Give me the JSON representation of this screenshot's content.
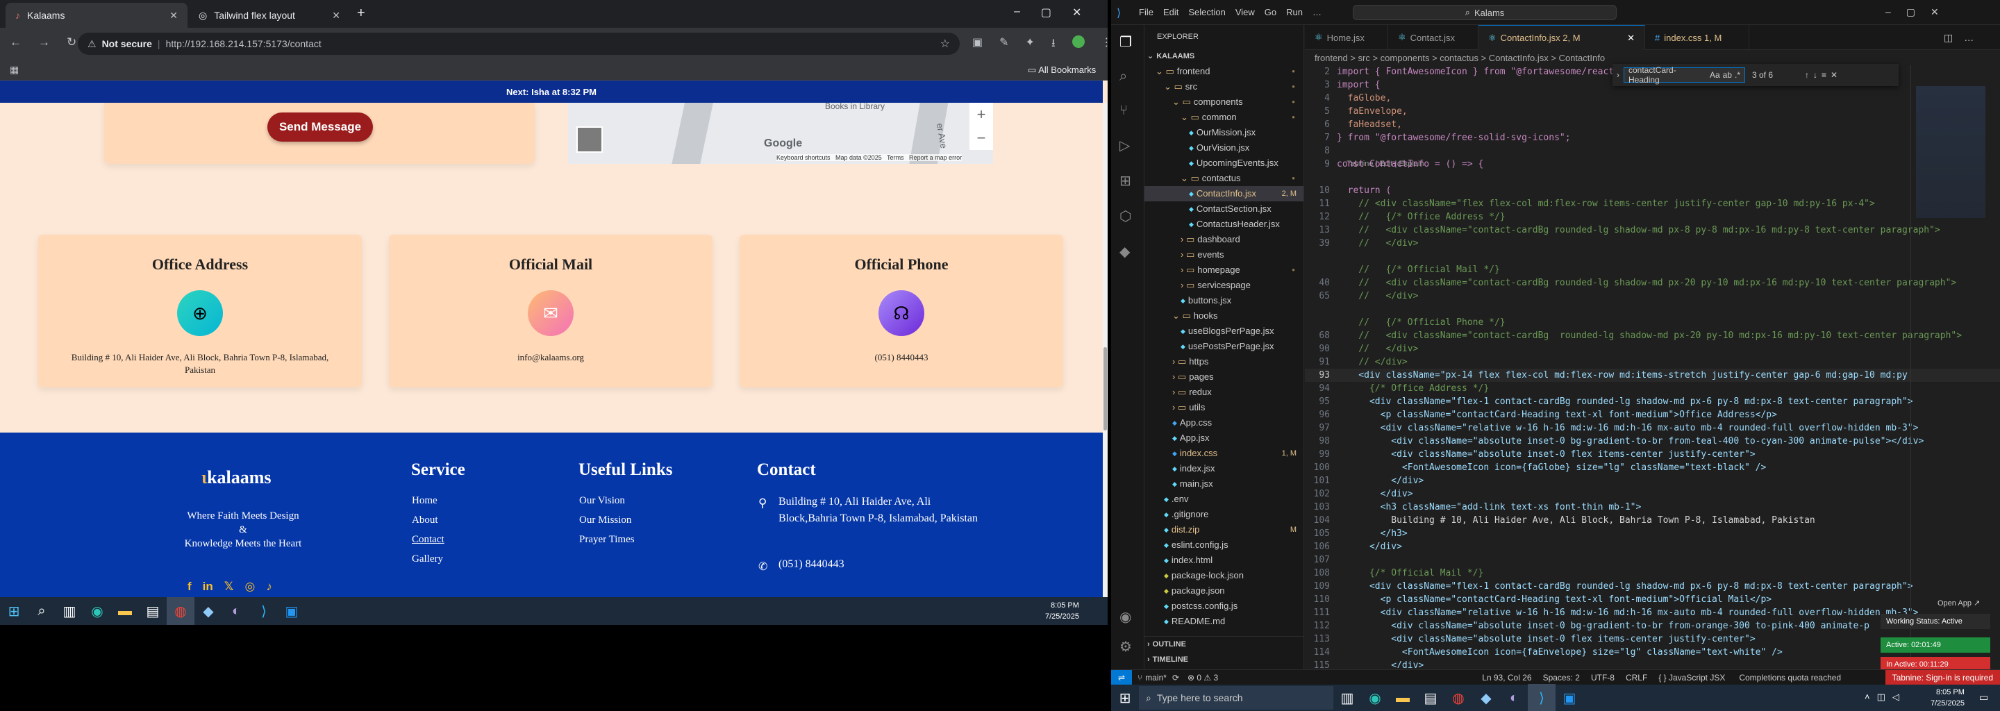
{
  "browser": {
    "tabs": [
      {
        "label": "Kalaams",
        "active": true
      },
      {
        "label": "Tailwind flex layout",
        "active": false
      }
    ],
    "new_tab": "+",
    "window_buttons": [
      "–",
      "▢",
      "✕"
    ],
    "not_secure": "Not secure",
    "url": "http://192.168.214.157:5173/contact",
    "all_bookmarks": "All Bookmarks"
  },
  "site": {
    "announcement": "Next: Isha at 8:32 PM",
    "send_button": "Send Message",
    "map": {
      "zoom_in": "+",
      "zoom_out": "−",
      "attribution": "Keyboard shortcuts   Map data ©2025   Terms   Report a map error",
      "google": "Google",
      "street_1": "Books in Library",
      "street_2": "er Ave"
    },
    "cards": [
      {
        "title": "Office Address",
        "icon": "globe-icon",
        "color": "#14b8a6",
        "text": "Building # 10, Ali Haider Ave, Ali Block, Bahria Town P-8, Islamabad, Pakistan"
      },
      {
        "title": "Official Mail",
        "icon": "envelope-icon",
        "color": "#ec4899",
        "text": "info@kalaams.org"
      },
      {
        "title": "Official Phone",
        "icon": "headset-icon",
        "color": "#6d28d9",
        "text": "(051) 8440443"
      }
    ],
    "footer": {
      "logo": "kalaams",
      "tagline_1": "Where Faith Meets Design",
      "tagline_2": "&",
      "tagline_3": "Knowledge Meets the Heart",
      "service_title": "Service",
      "service_links": [
        "Home",
        "About",
        "Contact",
        "Gallery"
      ],
      "useful_title": "Useful Links",
      "useful_links": [
        "Our Vision",
        "Our Mission",
        "Prayer Times"
      ],
      "contact_title": "Contact",
      "contact_address": "Building # 10, Ali Haider Ave, Ali Block,Bahria Town P-8, Islamabad, Pakistan",
      "contact_phone": "(051) 8440443",
      "socials": [
        "facebook-icon",
        "linkedin-icon",
        "x-icon",
        "instagram-icon",
        "tiktok-icon"
      ]
    }
  },
  "taskbar_left": {
    "time": "8:05 PM",
    "date": "7/25/2025"
  },
  "vscode": {
    "menu": [
      "File",
      "Edit",
      "Selection",
      "View",
      "Go",
      "Run",
      "…"
    ],
    "search": "Kalams",
    "explorer_title": "EXPLORER",
    "root": "KALAAMS",
    "tree": [
      {
        "d": 1,
        "t": "folder",
        "n": "frontend",
        "open": true,
        "dot": true
      },
      {
        "d": 2,
        "t": "folder",
        "n": "src",
        "open": true,
        "dot": true
      },
      {
        "d": 3,
        "t": "folder",
        "n": "components",
        "open": true,
        "dot": true
      },
      {
        "d": 4,
        "t": "folder",
        "n": "common",
        "open": true,
        "dot": true
      },
      {
        "d": 5,
        "t": "file",
        "n": "OurMission.jsx"
      },
      {
        "d": 5,
        "t": "file",
        "n": "OurVision.jsx"
      },
      {
        "d": 5,
        "t": "file",
        "n": "UpcomingEvents.jsx"
      },
      {
        "d": 4,
        "t": "folder",
        "n": "contactus",
        "open": true,
        "dot": true
      },
      {
        "d": 5,
        "t": "file",
        "n": "ContactInfo.jsx",
        "badge": "2, M",
        "selected": true
      },
      {
        "d": 5,
        "t": "file",
        "n": "ContactSection.jsx"
      },
      {
        "d": 5,
        "t": "file",
        "n": "ContactusHeader.jsx"
      },
      {
        "d": 4,
        "t": "folder",
        "n": "dashboard"
      },
      {
        "d": 4,
        "t": "folder",
        "n": "events"
      },
      {
        "d": 4,
        "t": "folder",
        "n": "homepage",
        "dot": true
      },
      {
        "d": 4,
        "t": "folder",
        "n": "servicespage"
      },
      {
        "d": 4,
        "t": "file",
        "n": "buttons.jsx"
      },
      {
        "d": 3,
        "t": "folder",
        "n": "hooks",
        "open": true
      },
      {
        "d": 4,
        "t": "file",
        "n": "useBlogsPerPage.jsx"
      },
      {
        "d": 4,
        "t": "file",
        "n": "usePostsPerPage.jsx"
      },
      {
        "d": 3,
        "t": "folder",
        "n": "https"
      },
      {
        "d": 3,
        "t": "folder",
        "n": "pages"
      },
      {
        "d": 3,
        "t": "folder",
        "n": "redux"
      },
      {
        "d": 3,
        "t": "folder",
        "n": "utils"
      },
      {
        "d": 3,
        "t": "file",
        "n": "App.css"
      },
      {
        "d": 3,
        "t": "file",
        "n": "App.jsx"
      },
      {
        "d": 3,
        "t": "file",
        "n": "index.css",
        "badge": "1, M"
      },
      {
        "d": 3,
        "t": "file",
        "n": "index.jsx"
      },
      {
        "d": 3,
        "t": "file",
        "n": "main.jsx"
      },
      {
        "d": 2,
        "t": "file",
        "n": ".env"
      },
      {
        "d": 2,
        "t": "file",
        "n": ".gitignore"
      },
      {
        "d": 2,
        "t": "file",
        "n": "dist.zip",
        "badge": "M"
      },
      {
        "d": 2,
        "t": "file",
        "n": "eslint.config.js"
      },
      {
        "d": 2,
        "t": "file",
        "n": "index.html"
      },
      {
        "d": 2,
        "t": "file",
        "n": "package-lock.json"
      },
      {
        "d": 2,
        "t": "file",
        "n": "package.json"
      },
      {
        "d": 2,
        "t": "file",
        "n": "postcss.config.js"
      },
      {
        "d": 2,
        "t": "file",
        "n": "README.md"
      }
    ],
    "outline": "OUTLINE",
    "timeline": "TIMELINE",
    "tabs": [
      {
        "n": "Home.jsx"
      },
      {
        "n": "Contact.jsx"
      },
      {
        "n": "ContactInfo.jsx 2, M",
        "active": true
      },
      {
        "n": "index.css 1, M"
      }
    ],
    "breadcrumb": "frontend > src > components > contactus > ContactInfo.jsx > ContactInfo",
    "find": {
      "query": "contactCard-Heading",
      "count": "3 of 6"
    },
    "codelens": "Tabnine | Edit | Explain",
    "lines": [
      {
        "n": "2",
        "c": "import { FontAwesomeIcon } from \"@fortawesome/react-fontawesome\";"
      },
      {
        "n": "3",
        "c": "import {"
      },
      {
        "n": "4",
        "c": "  faGlobe,"
      },
      {
        "n": "5",
        "c": "  faEnvelope,"
      },
      {
        "n": "6",
        "c": "  faHeadset,"
      },
      {
        "n": "7",
        "c": "} from \"@fortawesome/free-solid-svg-icons\";"
      },
      {
        "n": "8",
        "c": ""
      },
      {
        "n": "9",
        "c": "const ContactInfo = () => {"
      },
      {
        "n": "10",
        "c": "  return ("
      },
      {
        "n": "11",
        "c": "    // <div className=\"flex flex-col md:flex-row items-center justify-center gap-10 md:py-16 px-4\">"
      },
      {
        "n": "12",
        "c": "    //   {/* Office Address */}"
      },
      {
        "n": "13",
        "c": "    //   <div className=\"contact-cardBg rounded-lg shadow-md px-8 py-8 md:px-16 md:py-8 text-center paragraph\">"
      },
      {
        "n": "39",
        "c": "    //   </div>"
      },
      {
        "n": "",
        "c": ""
      },
      {
        "n": "",
        "c": "    //   {/* Official Mail */}"
      },
      {
        "n": "40",
        "c": "    //   <div className=\"contact-cardBg rounded-lg shadow-md px-20 py-10 md:px-16 md:py-10 text-center paragraph\">"
      },
      {
        "n": "65",
        "c": "    //   </div>"
      },
      {
        "n": "",
        "c": ""
      },
      {
        "n": "",
        "c": "    //   {/* Official Phone */}"
      },
      {
        "n": "68",
        "c": "    //   <div className=\"contact-cardBg  rounded-lg shadow-md px-20 py-10 md:px-16 md:py-10 text-center paragraph\">"
      },
      {
        "n": "90",
        "c": "    //   </div>"
      },
      {
        "n": "91",
        "c": "    // </div>"
      },
      {
        "n": "93",
        "c": "    <div className=\"px-14 flex flex-col md:flex-row md:items-stretch justify-center gap-6 md:gap-10 md:py"
      },
      {
        "n": "94",
        "c": "      {/* Office Address */}"
      },
      {
        "n": "95",
        "c": "      <div className=\"flex-1 contact-cardBg rounded-lg shadow-md px-6 py-8 md:px-8 text-center paragraph\">"
      },
      {
        "n": "96",
        "c": "        <p className=\"contactCard-Heading text-xl font-medium\">Office Address</p>"
      },
      {
        "n": "97",
        "c": "        <div className=\"relative w-16 h-16 md:w-16 md:h-16 mx-auto mb-4 rounded-full overflow-hidden mb-3\">"
      },
      {
        "n": "98",
        "c": "          <div className=\"absolute inset-0 bg-gradient-to-br from-teal-400 to-cyan-300 animate-pulse\"></div>"
      },
      {
        "n": "99",
        "c": "          <div className=\"absolute inset-0 flex items-center justify-center\">"
      },
      {
        "n": "100",
        "c": "            <FontAwesomeIcon icon={faGlobe} size=\"lg\" className=\"text-black\" />"
      },
      {
        "n": "101",
        "c": "          </div>"
      },
      {
        "n": "102",
        "c": "        </div>"
      },
      {
        "n": "103",
        "c": "        <h3 className=\"add-link text-xs font-thin mb-1\">"
      },
      {
        "n": "104",
        "c": "          Building # 10, Ali Haider Ave, Ali Block, Bahria Town P-8, Islamabad, Pakistan"
      },
      {
        "n": "105",
        "c": "        </h3>"
      },
      {
        "n": "106",
        "c": "      </div>"
      },
      {
        "n": "107",
        "c": ""
      },
      {
        "n": "108",
        "c": "      {/* Official Mail */}"
      },
      {
        "n": "109",
        "c": "      <div className=\"flex-1 contact-cardBg rounded-lg shadow-md px-6 py-8 md:px-8 text-center paragraph\">"
      },
      {
        "n": "110",
        "c": "        <p className=\"contactCard-Heading text-xl font-medium\">Official Mail</p>"
      },
      {
        "n": "111",
        "c": "        <div className=\"relative w-16 h-16 md:w-16 md:h-16 mx-auto mb-4 rounded-full overflow-hidden mb-3\">"
      },
      {
        "n": "112",
        "c": "          <div className=\"absolute inset-0 bg-gradient-to-br from-orange-300 to-pink-400 animate-p"
      },
      {
        "n": "113",
        "c": "          <div className=\"absolute inset-0 flex items-center justify-center\">"
      },
      {
        "n": "114",
        "c": "            <FontAwesomeIcon icon={faEnvelope} size=\"lg\" className=\"text-white\" />"
      },
      {
        "n": "115",
        "c": "          </div>"
      }
    ],
    "tabnine_badges": {
      "open_app": "Open App ↗",
      "working": "Working Status: Active",
      "active": "Active: 02:01:49",
      "inactive": "In Active: 00:11:29"
    },
    "status": {
      "branch": "main*",
      "sync": "⟳",
      "problems": "⊗ 0 ⚠ 3",
      "pos": "Ln 93, Col 26",
      "spaces": "Spaces: 2",
      "enc": "UTF-8",
      "eol": "CRLF",
      "lang": "{ } JavaScript JSX",
      "quota": "Completions quota reached",
      "tabnine": "Tabnine: Sign-in is required"
    }
  },
  "taskbar_right": {
    "search_placeholder": "Type here to search",
    "time": "8:05 PM",
    "date": "7/25/2025"
  }
}
